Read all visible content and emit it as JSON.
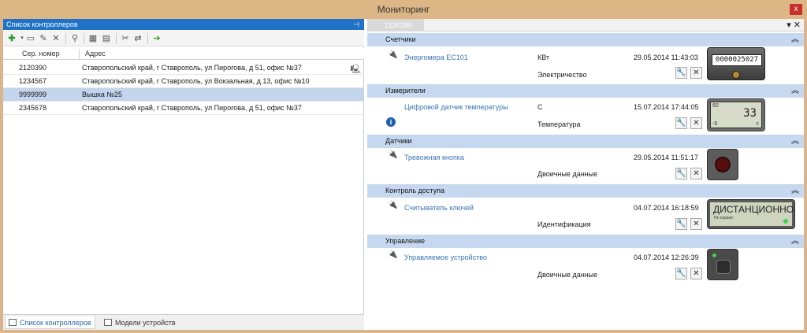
{
  "window": {
    "title": "Мониторинг",
    "close": "x"
  },
  "left_panel": {
    "title": "Список контроллеров",
    "pin": "⊣",
    "columns": {
      "serial": "Сер. номер",
      "address": "Адрес"
    },
    "rows": [
      {
        "serial": "2120390",
        "address": "Ставропольский край, г Ставрополь, ул Пирогова, д 51, офис №37",
        "selected": false
      },
      {
        "serial": "1234567",
        "address": "Ставропольский край, г Ставрополь, ул Вокзальная, д 13, офис №10",
        "selected": false
      },
      {
        "serial": "9999999",
        "address": "Вышка №25",
        "selected": true
      },
      {
        "serial": "2345678",
        "address": "Ставропольский край, г Ставрополь, ул Пирогова, д 51, офис №37",
        "selected": false
      }
    ],
    "tabs": [
      {
        "label": "Список контроллеров",
        "active": true
      },
      {
        "label": "Модели устройств",
        "active": false
      }
    ]
  },
  "right_panel": {
    "doc_tab": "2120390",
    "groups": [
      {
        "title": "Счетчики",
        "device": {
          "name": "Энергомера ЕС101",
          "unit": "КВт",
          "datetime": "29.05.2014 11:43:03",
          "type": "Электричество",
          "widget": "meter",
          "reading": "0000025027"
        }
      },
      {
        "title": "Измерители",
        "device": {
          "name": "Цифровой датчик температуры",
          "unit": "С",
          "datetime": "15.07.2014 17:44:05",
          "type": "Температура",
          "widget": "lcd",
          "value": "33",
          "top_mark": "60",
          "low_mark": "-5",
          "unit_mark": "c"
        }
      },
      {
        "title": "Датчики",
        "device": {
          "name": "Тревожная кнопка",
          "unit": "",
          "datetime": "29.05.2014 11:51:17",
          "type": "Двоичные данные",
          "widget": "button"
        }
      },
      {
        "title": "Контроль доступа",
        "device": {
          "name": "Считыватель ключей",
          "unit": "",
          "datetime": "04.07.2014 16:18:59",
          "type": "Идентификация",
          "widget": "display",
          "display_main": "ДИСТАНЦИОННО",
          "display_sub": "Не охране"
        }
      },
      {
        "title": "Управление",
        "device": {
          "name": "Управляемое устройство",
          "unit": "",
          "datetime": "04.07.2014 12:26:39",
          "type": "Двоичные данные",
          "widget": "device"
        }
      }
    ]
  }
}
